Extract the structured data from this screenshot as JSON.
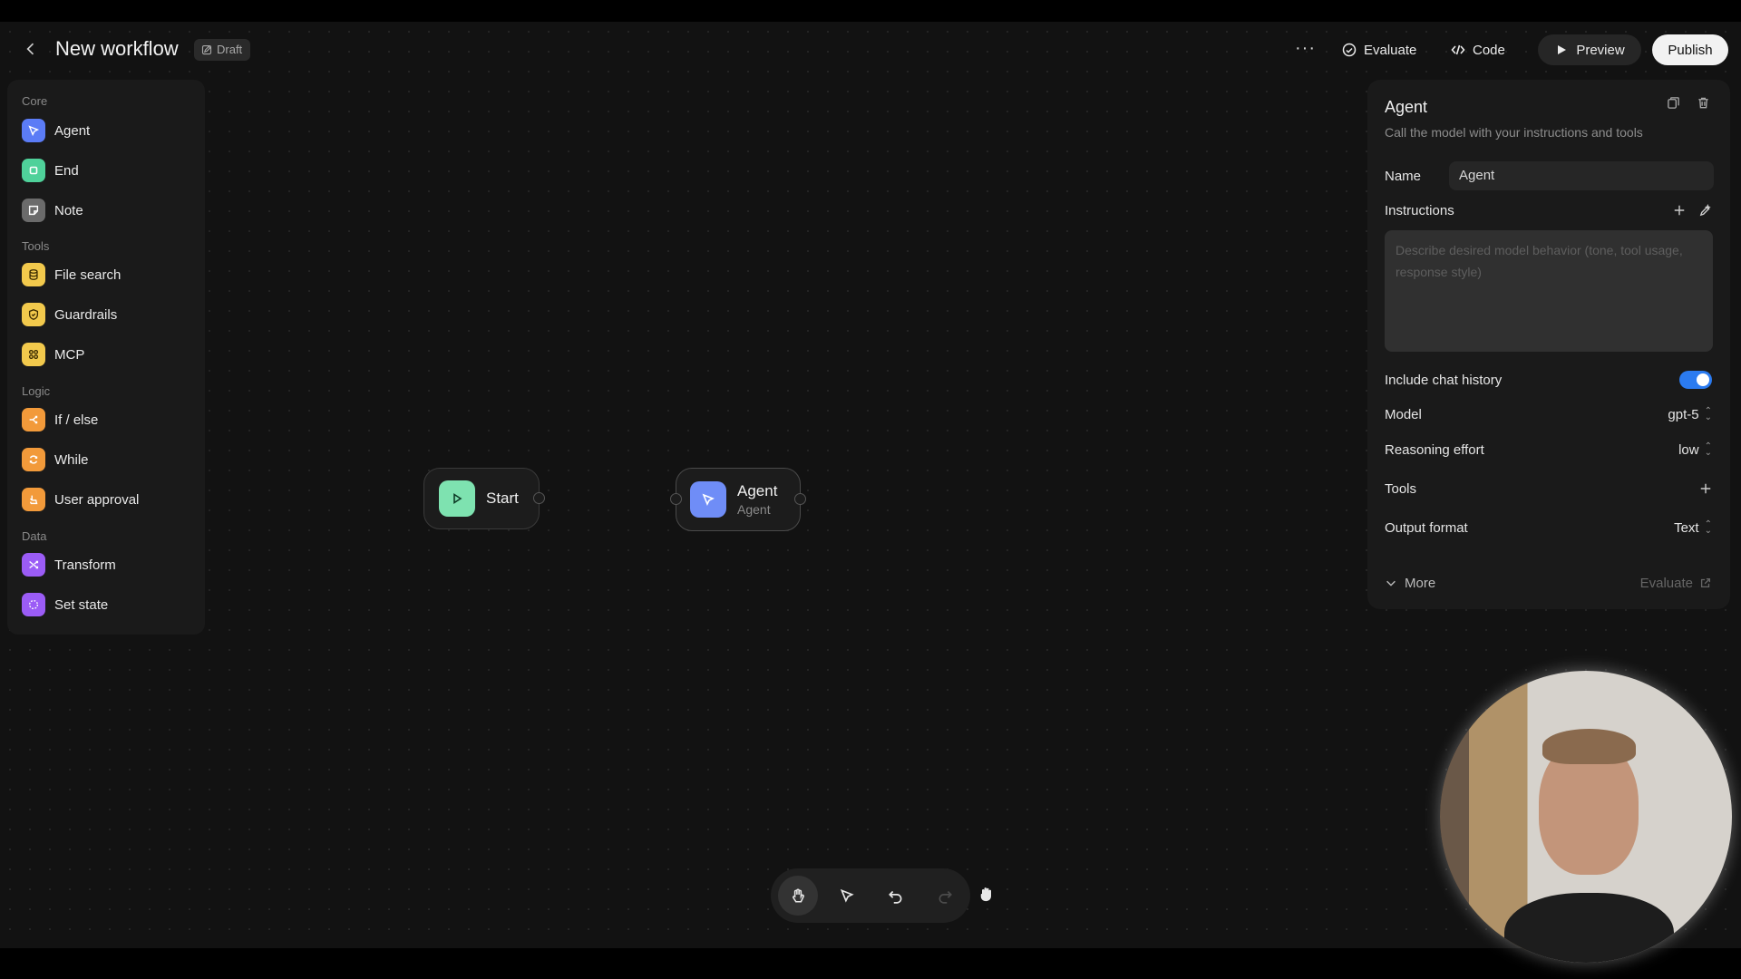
{
  "header": {
    "title": "New workflow",
    "status_badge": "Draft",
    "evaluate_label": "Evaluate",
    "code_label": "Code",
    "preview_label": "Preview",
    "publish_label": "Publish"
  },
  "palette": {
    "sections": [
      {
        "title": "Core",
        "items": [
          {
            "label": "Agent",
            "color": "#5b7cf6",
            "icon": "agent-icon"
          },
          {
            "label": "End",
            "color": "#4fd19a",
            "icon": "stop-icon"
          },
          {
            "label": "Note",
            "color": "#6b6b6b",
            "icon": "note-icon"
          }
        ]
      },
      {
        "title": "Tools",
        "items": [
          {
            "label": "File search",
            "color": "#f2c94c",
            "icon": "database-icon"
          },
          {
            "label": "Guardrails",
            "color": "#f2c94c",
            "icon": "shield-icon"
          },
          {
            "label": "MCP",
            "color": "#f2c94c",
            "icon": "mcp-icon"
          }
        ]
      },
      {
        "title": "Logic",
        "items": [
          {
            "label": "If / else",
            "color": "#f29a3a",
            "icon": "branch-icon"
          },
          {
            "label": "While",
            "color": "#f29a3a",
            "icon": "loop-icon"
          },
          {
            "label": "User approval",
            "color": "#f29a3a",
            "icon": "approval-icon"
          }
        ]
      },
      {
        "title": "Data",
        "items": [
          {
            "label": "Transform",
            "color": "#9b5cf6",
            "icon": "transform-icon"
          },
          {
            "label": "Set state",
            "color": "#9b5cf6",
            "icon": "state-icon"
          }
        ]
      }
    ]
  },
  "canvas": {
    "start_node": {
      "title": "Start",
      "color": "#7ee2b0"
    },
    "agent_node": {
      "title": "Agent",
      "subtitle": "Agent",
      "color": "#6f8df7"
    }
  },
  "inspector": {
    "title": "Agent",
    "description": "Call the model with your instructions and tools",
    "name_label": "Name",
    "name_value": "Agent",
    "instructions_label": "Instructions",
    "instructions_placeholder": "Describe desired model behavior (tone, tool usage, response style)",
    "chat_history_label": "Include chat history",
    "chat_history_on": true,
    "model_label": "Model",
    "model_value": "gpt-5",
    "reasoning_label": "Reasoning effort",
    "reasoning_value": "low",
    "tools_label": "Tools",
    "output_label": "Output format",
    "output_value": "Text",
    "more_label": "More",
    "evaluate_link": "Evaluate",
    "accent": "#2b7bf0"
  }
}
